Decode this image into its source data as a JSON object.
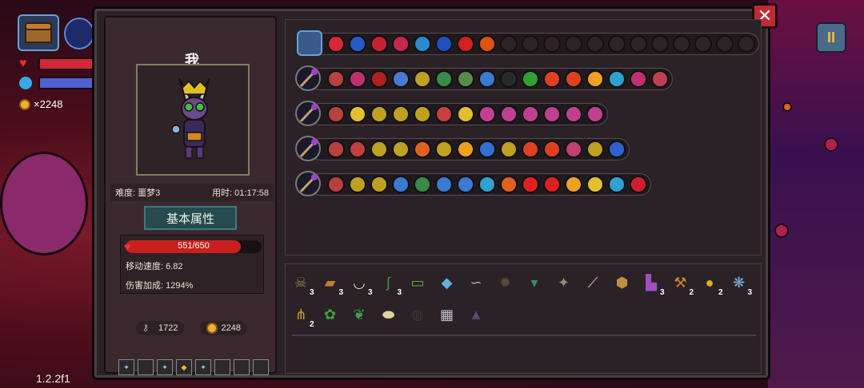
{
  "hud": {
    "coin_count": "×2248",
    "version": "1.2.2f1",
    "pause_label": "II"
  },
  "panel": {
    "close_label": "✕",
    "player_name": "我",
    "difficulty": "难度: 噩梦3",
    "time_used": "用时: 01:17:58",
    "attr_button": "基本属性",
    "hp_text": "551/650",
    "hp_current": 551,
    "hp_max": 650,
    "move_speed": "移动速度: 6.82",
    "damage_bonus": "伤害加成: 1294%",
    "keys": "1722",
    "coins": "2248"
  },
  "skill_rows": [
    {
      "filled": [
        "#d82838",
        "#2a5ac8",
        "#c82030",
        "#c82848",
        "#2a8ad0",
        "#2050c0",
        "#d02020",
        "#e05010"
      ],
      "empty": 12,
      "has_chest": true
    },
    {
      "filled": [
        "#b84040",
        "#c03070",
        "#b02020",
        "#4a7ad0",
        "#c0a020",
        "#3a8a4a",
        "#5a8a4a",
        "#3a7ad0",
        "#2a2a2a",
        "#30a030",
        "#e04020",
        "#e04020",
        "#f0a020",
        "#30a0d0",
        "#c03070",
        "#c04050"
      ],
      "empty": 0
    },
    {
      "filled": [
        "#b84040",
        "#e0c030",
        "#c0a020",
        "#c0a020",
        "#c0a020",
        "#c84040",
        "#e0c030",
        "#c04090",
        "#c04090",
        "#c04090",
        "#c04090",
        "#c04090",
        "#c04090"
      ],
      "empty": 0
    },
    {
      "filled": [
        "#b84040",
        "#c04040",
        "#c0a020",
        "#c0a020",
        "#e06020",
        "#c0a020",
        "#f0a020",
        "#3070d0",
        "#c0a020",
        "#e04020",
        "#e04020",
        "#c04070",
        "#c0a020",
        "#3060d0"
      ],
      "empty": 0
    },
    {
      "filled": [
        "#b84040",
        "#c0a020",
        "#c0a020",
        "#3a7ad0",
        "#3a8a4a",
        "#3a7ad0",
        "#3a7ad0",
        "#30a0d0",
        "#e06020",
        "#e02020",
        "#e02020",
        "#f0a020",
        "#e0c030",
        "#30a0d0",
        "#d02030"
      ],
      "empty": 0
    }
  ],
  "items": {
    "row1": [
      {
        "icon": "☠",
        "color": "#7a8a40",
        "count": "3"
      },
      {
        "icon": "▰",
        "color": "#c0802a",
        "count": "3"
      },
      {
        "icon": "◡",
        "color": "#e0d8c0",
        "count": "3"
      },
      {
        "icon": "∫",
        "color": "#3a9a40",
        "count": "3"
      },
      {
        "icon": "▭",
        "color": "#60b030",
        "count": ""
      },
      {
        "icon": "◆",
        "color": "#60b0e0",
        "count": ""
      },
      {
        "icon": "∽",
        "color": "#a0b0d0",
        "count": ""
      },
      {
        "icon": "✹",
        "color": "#5a4a3a",
        "count": ""
      },
      {
        "icon": "▾",
        "color": "#3a8a60",
        "count": ""
      },
      {
        "icon": "✦",
        "color": "#8a9070",
        "count": ""
      },
      {
        "icon": "⟋",
        "color": "#e8c0c0",
        "count": ""
      },
      {
        "icon": "⬢",
        "color": "#c09040",
        "count": ""
      },
      {
        "icon": "▙",
        "color": "#a050c0",
        "count": "3"
      },
      {
        "icon": "⚒",
        "color": "#d08a20",
        "count": "2"
      },
      {
        "icon": "●",
        "color": "#e0b020",
        "count": "2"
      },
      {
        "icon": "❋",
        "color": "#80b0e0",
        "count": "3"
      }
    ],
    "row2": [
      {
        "icon": "⋔",
        "color": "#c0a020",
        "count": "2"
      },
      {
        "icon": "✿",
        "color": "#40a040",
        "count": ""
      },
      {
        "icon": "❦",
        "color": "#40a040",
        "count": ""
      },
      {
        "icon": "⬬",
        "color": "#e0d0a0",
        "count": ""
      },
      {
        "icon": "◍",
        "color": "#3a3a3a",
        "count": ""
      },
      {
        "icon": "▦",
        "color": "#c0c0d0",
        "count": ""
      },
      {
        "icon": "▲",
        "color": "#5a4a6a",
        "count": ""
      }
    ]
  }
}
